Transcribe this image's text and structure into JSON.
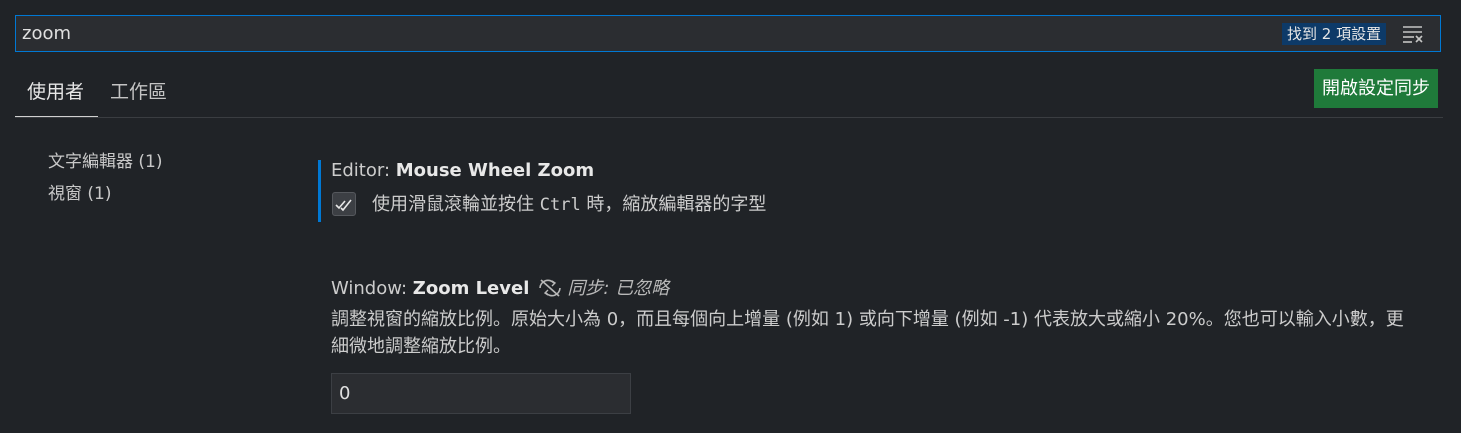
{
  "search": {
    "value": "zoom",
    "results_label": "找到 2 項設置"
  },
  "tabs": [
    {
      "label": "使用者"
    },
    {
      "label": "工作區"
    }
  ],
  "sync_button_label": "開啟設定同步",
  "toc": [
    {
      "label": "文字編輯器 (1)"
    },
    {
      "label": "視窗 (1)"
    }
  ],
  "settings": [
    {
      "category": "Editor: ",
      "name": "Mouse Wheel Zoom",
      "checked": true,
      "desc_before": "使用滑鼠滾輪並按住 ",
      "desc_key": "Ctrl",
      "desc_after": " 時，縮放編輯器的字型"
    },
    {
      "category": "Window: ",
      "name": "Zoom Level",
      "sync_ignored": "同步: 已忽略",
      "description": "調整視窗的縮放比例。原始大小為 0，而且每個向上增量 (例如 1) 或向下增量 (例如 -1) 代表放大或縮小 20%。您也可以輸入小數，更細微地調整縮放比例。",
      "value": "0"
    }
  ],
  "colors": {
    "accent": "#0078d4",
    "sync_button": "#1f7a3a",
    "background": "#202327"
  }
}
